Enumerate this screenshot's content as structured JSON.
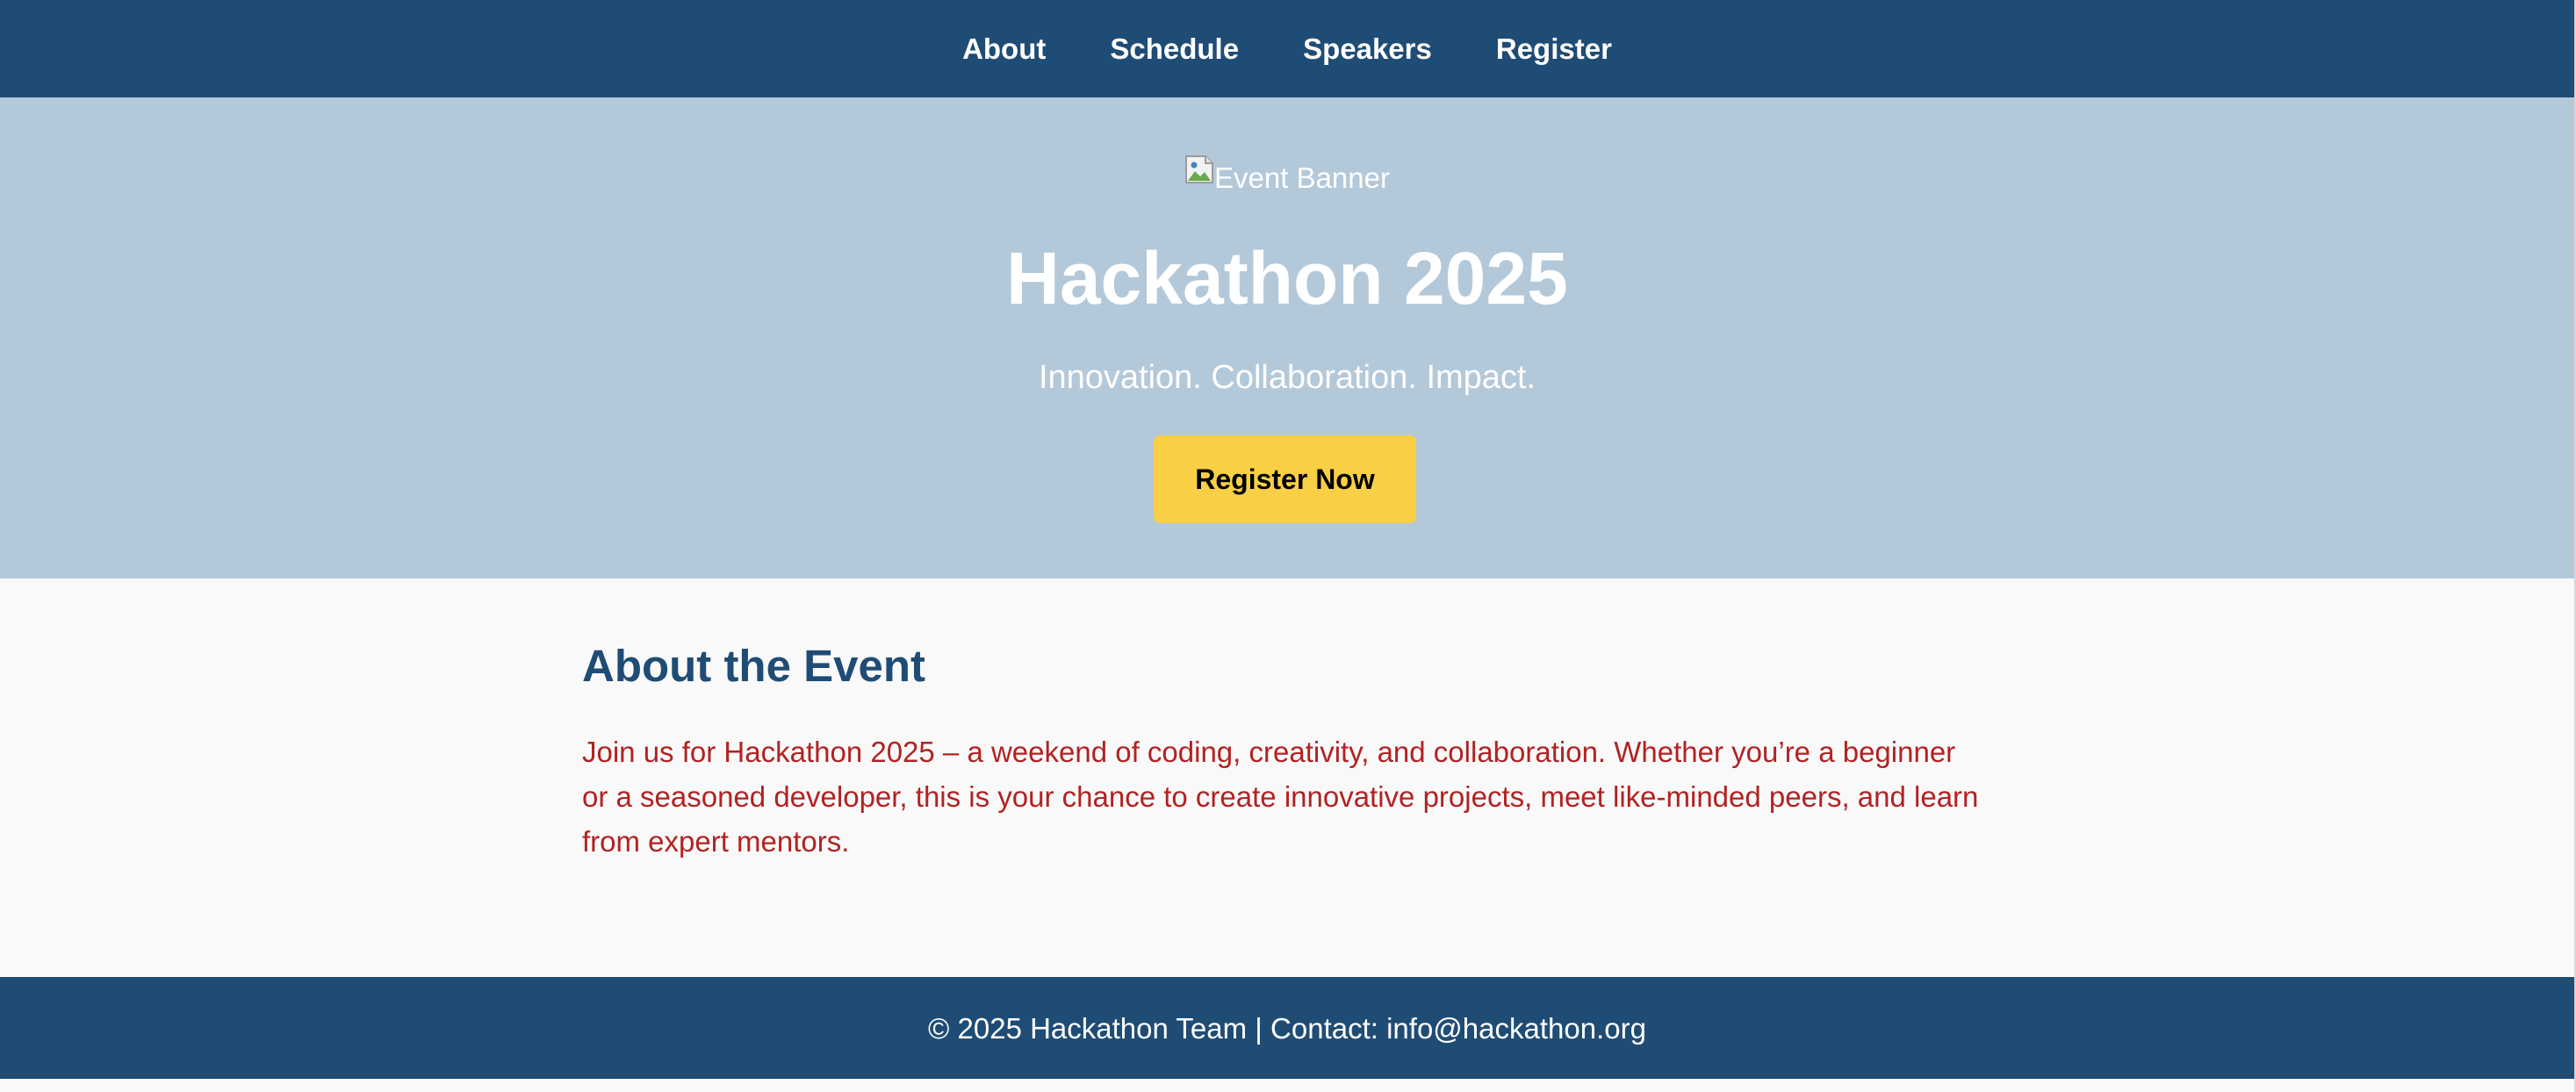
{
  "nav": {
    "items": [
      {
        "label": "About"
      },
      {
        "label": "Schedule"
      },
      {
        "label": "Speakers"
      },
      {
        "label": "Register"
      }
    ]
  },
  "hero": {
    "banner_alt": "Event Banner",
    "banner_icon": "broken-image-icon",
    "title": "Hackathon 2025",
    "tagline": "Innovation. Collaboration. Impact.",
    "cta_label": "Register Now"
  },
  "about": {
    "title": "About the Event",
    "text": "Join us for Hackathon 2025 – a weekend of coding, creativity, and collaboration. Whether you’re a beginner or a seasoned developer, this is your chance to create innovative projects, meet like-minded peers, and learn from expert mentors."
  },
  "footer": {
    "text": "© 2025 Hackathon Team | Contact: info@hackathon.org"
  },
  "colors": {
    "nav_bg": "#1f4c75",
    "hero_bg": "#b3c9da",
    "cta_bg": "#f9cf46",
    "heading": "#1f4c75",
    "body_text": "#b22222",
    "page_bg": "#f9f9f9"
  }
}
